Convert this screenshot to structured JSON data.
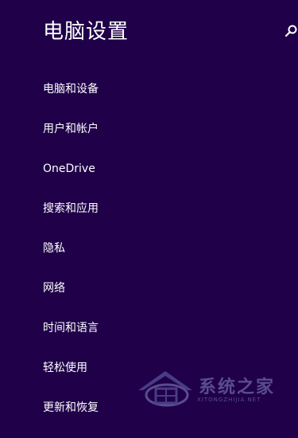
{
  "header": {
    "title": "电脑设置",
    "search_icon": "search-icon"
  },
  "nav": {
    "items": [
      {
        "label": "电脑和设备"
      },
      {
        "label": "用户和帐户"
      },
      {
        "label": "OneDrive"
      },
      {
        "label": "搜索和应用"
      },
      {
        "label": "隐私"
      },
      {
        "label": "网络"
      },
      {
        "label": "时间和语言"
      },
      {
        "label": "轻松使用"
      },
      {
        "label": "更新和恢复"
      }
    ]
  },
  "watermark": {
    "text": "系统之家",
    "sub": "XITONGZHIJIA.NET"
  },
  "colors": {
    "background": "#1f0049",
    "text": "#ffffff"
  }
}
